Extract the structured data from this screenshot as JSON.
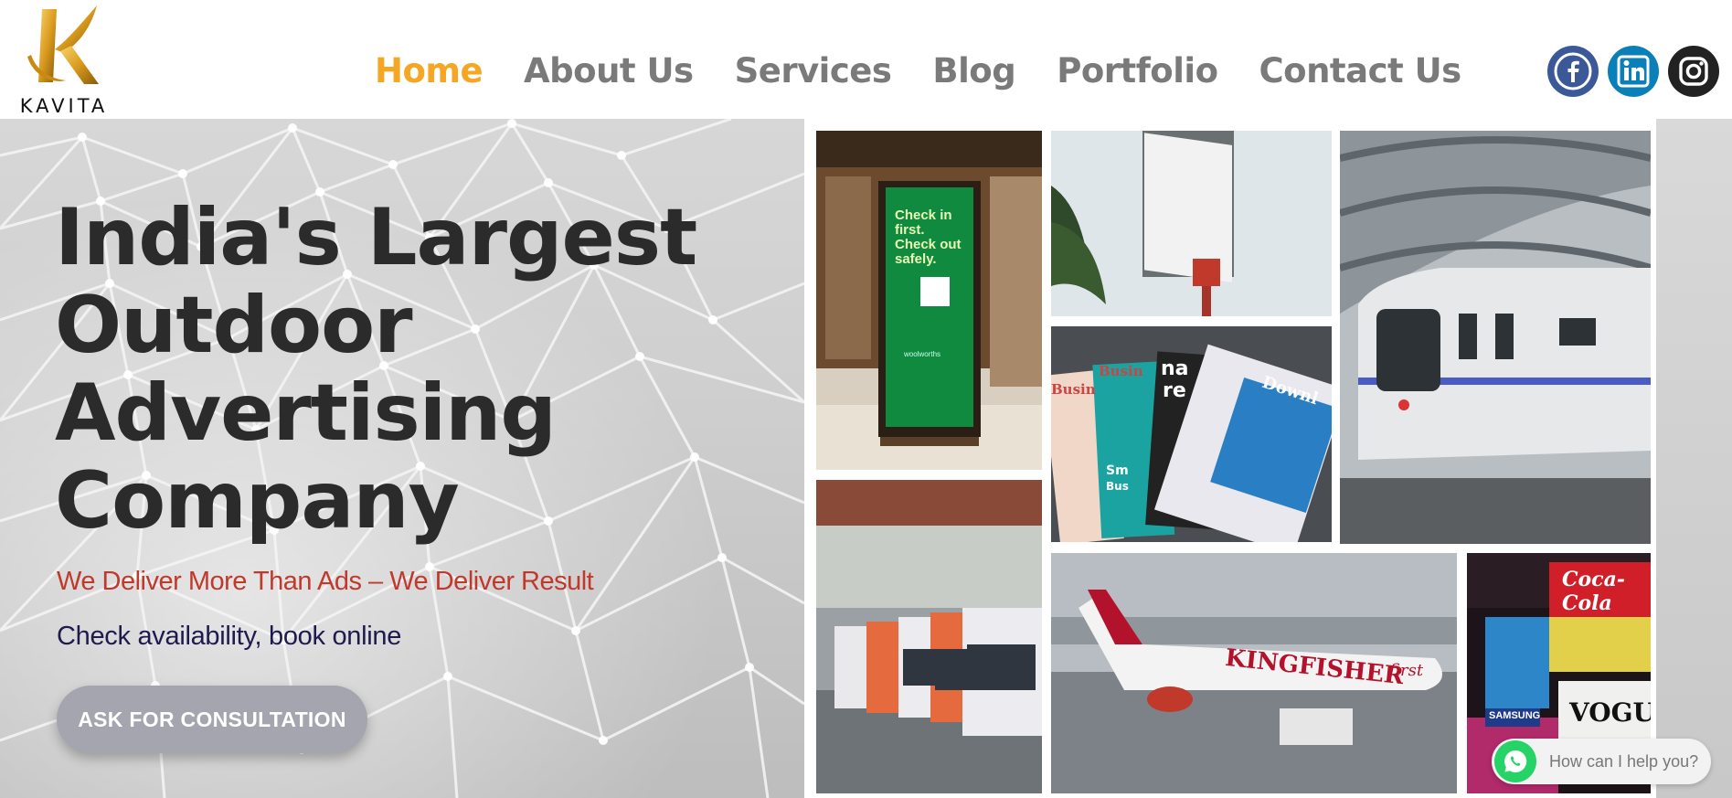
{
  "brand": {
    "logo_letter": "K",
    "name": "KAVITA"
  },
  "nav": {
    "items": [
      {
        "label": "Home",
        "active": true
      },
      {
        "label": "About Us",
        "active": false
      },
      {
        "label": "Services",
        "active": false
      },
      {
        "label": "Blog",
        "active": false
      },
      {
        "label": "Portfolio",
        "active": false
      },
      {
        "label": "Contact Us",
        "active": false
      }
    ]
  },
  "socials": [
    {
      "icon": "facebook-icon",
      "color": "#3b5998"
    },
    {
      "icon": "linkedin-icon",
      "color": "#0a7fb8"
    },
    {
      "icon": "instagram-icon",
      "color": "#222222"
    }
  ],
  "hero": {
    "title_lines": [
      "India's Largest",
      "Outdoor",
      "Advertising",
      "Company"
    ],
    "tagline": "We Deliver More Than Ads – We Deliver Result",
    "subtext": "Check availability, book online",
    "cta_label": "ASK FOR CONSULTATION"
  },
  "collage": {
    "kiosk_text": [
      "Check in",
      "first.",
      "Check out",
      "safely."
    ],
    "kiosk_brand": "woolworths",
    "magazine_labels": [
      "Busin",
      "Busin",
      "Downl",
      "na",
      "re",
      "Sm",
      "Bus"
    ],
    "plane_text": [
      "KINGFISHER",
      "first"
    ],
    "times_square_labels": [
      "Coca-Cola",
      "SAMSUNG",
      "VOGUE"
    ]
  },
  "whatsapp": {
    "label": "How can I help you?"
  },
  "colors": {
    "accent": "#f5a623",
    "nav_text": "#7a7a7a",
    "tagline": "#c0392b",
    "subtext": "#1f1a4d",
    "cta_bg": "#a4a5ae"
  }
}
